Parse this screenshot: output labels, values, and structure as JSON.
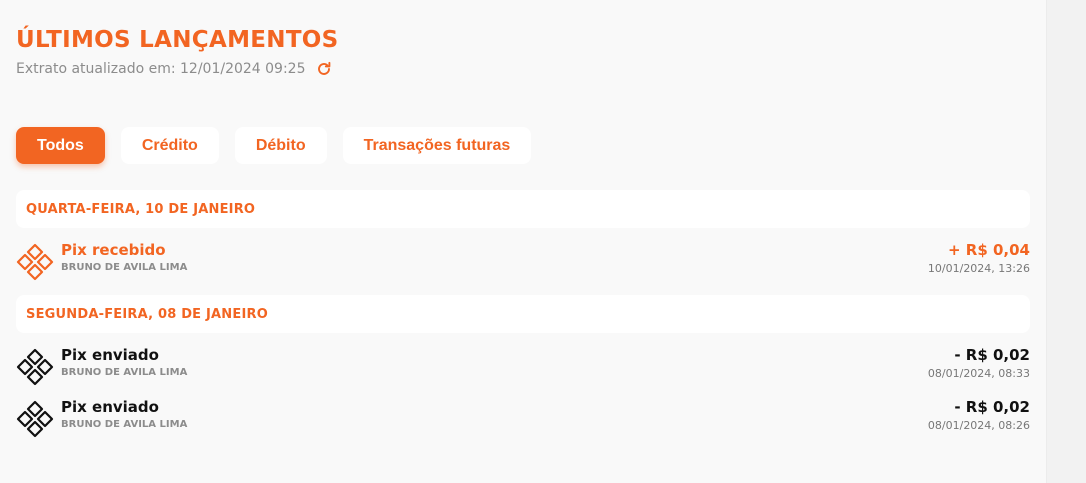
{
  "header": {
    "title": "ÚLTIMOS LANÇAMENTOS",
    "updated_text": "Extrato atualizado em: 12/01/2024 09:25",
    "refresh_icon": "refresh-icon"
  },
  "filters": {
    "all": "Todos",
    "credit": "Crédito",
    "debit": "Débito",
    "future": "Transações futuras",
    "selected": "Todos"
  },
  "days": [
    {
      "label": "QUARTA-FEIRA, 10 DE JANEIRO",
      "transactions": [
        {
          "type": "credit",
          "name": "Pix recebido",
          "person": "BRUNO DE AVILA LIMA",
          "amount": "+ R$ 0,04",
          "datetime": "10/01/2024, 13:26",
          "icon": "pix-icon"
        }
      ]
    },
    {
      "label": "SEGUNDA-FEIRA, 08 DE JANEIRO",
      "transactions": [
        {
          "type": "debit",
          "name": "Pix enviado",
          "person": "BRUNO DE AVILA LIMA",
          "amount": "- R$ 0,02",
          "datetime": "08/01/2024, 08:33",
          "icon": "pix-icon"
        },
        {
          "type": "debit",
          "name": "Pix enviado",
          "person": "BRUNO DE AVILA LIMA",
          "amount": "- R$ 0,02",
          "datetime": "08/01/2024, 08:26",
          "icon": "pix-icon"
        }
      ]
    }
  ],
  "colors": {
    "accent": "#f26522",
    "debit_text": "#111111",
    "muted": "#8c8c8c",
    "background": "#f9f9f9"
  }
}
